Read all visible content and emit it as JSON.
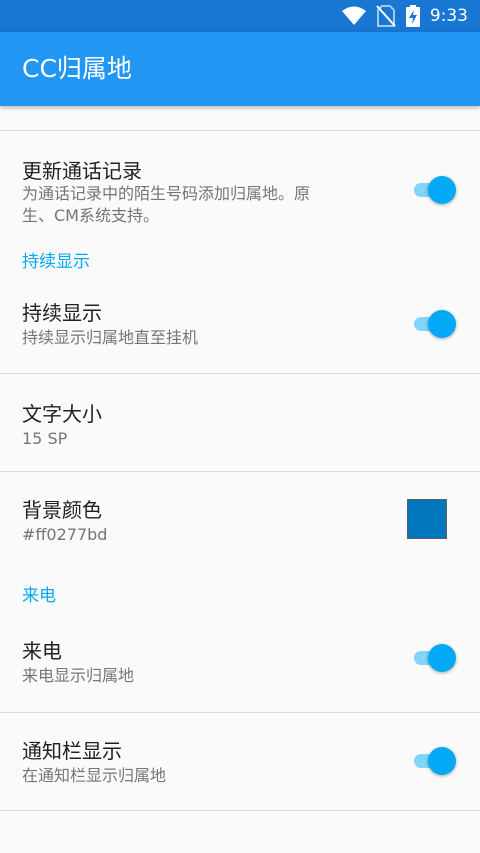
{
  "status_bar": {
    "time": "9:33",
    "icons": [
      "wifi-icon",
      "no-sim-icon",
      "battery-charging-icon"
    ]
  },
  "app_bar": {
    "title": "CC归属地"
  },
  "prefs": {
    "update_call_log": {
      "title": "更新通话记录",
      "summary_line1": "为通话记录中的陌生号码添加归属地。原",
      "summary_line2": "生、CM系统支持。",
      "enabled": true
    },
    "category_persistent": "持续显示",
    "persistent": {
      "title": "持续显示",
      "summary": "持续显示归属地直至挂机",
      "enabled": true
    },
    "text_size": {
      "title": "文字大小",
      "summary": "15 SP"
    },
    "background_color": {
      "title": "背景颜色",
      "summary": "#ff0277bd",
      "color": "#0277bd"
    },
    "category_incoming": "来电",
    "incoming": {
      "title": "来电",
      "summary": "来电显示归属地",
      "enabled": true
    },
    "notification": {
      "title": "通知栏显示",
      "summary": "在通知栏显示归属地",
      "enabled": true
    }
  },
  "colors": {
    "status_bar": "#1976d2",
    "app_bar": "#2196f3",
    "accent": "#03a9f4",
    "switch_track": "#81d4fa"
  }
}
